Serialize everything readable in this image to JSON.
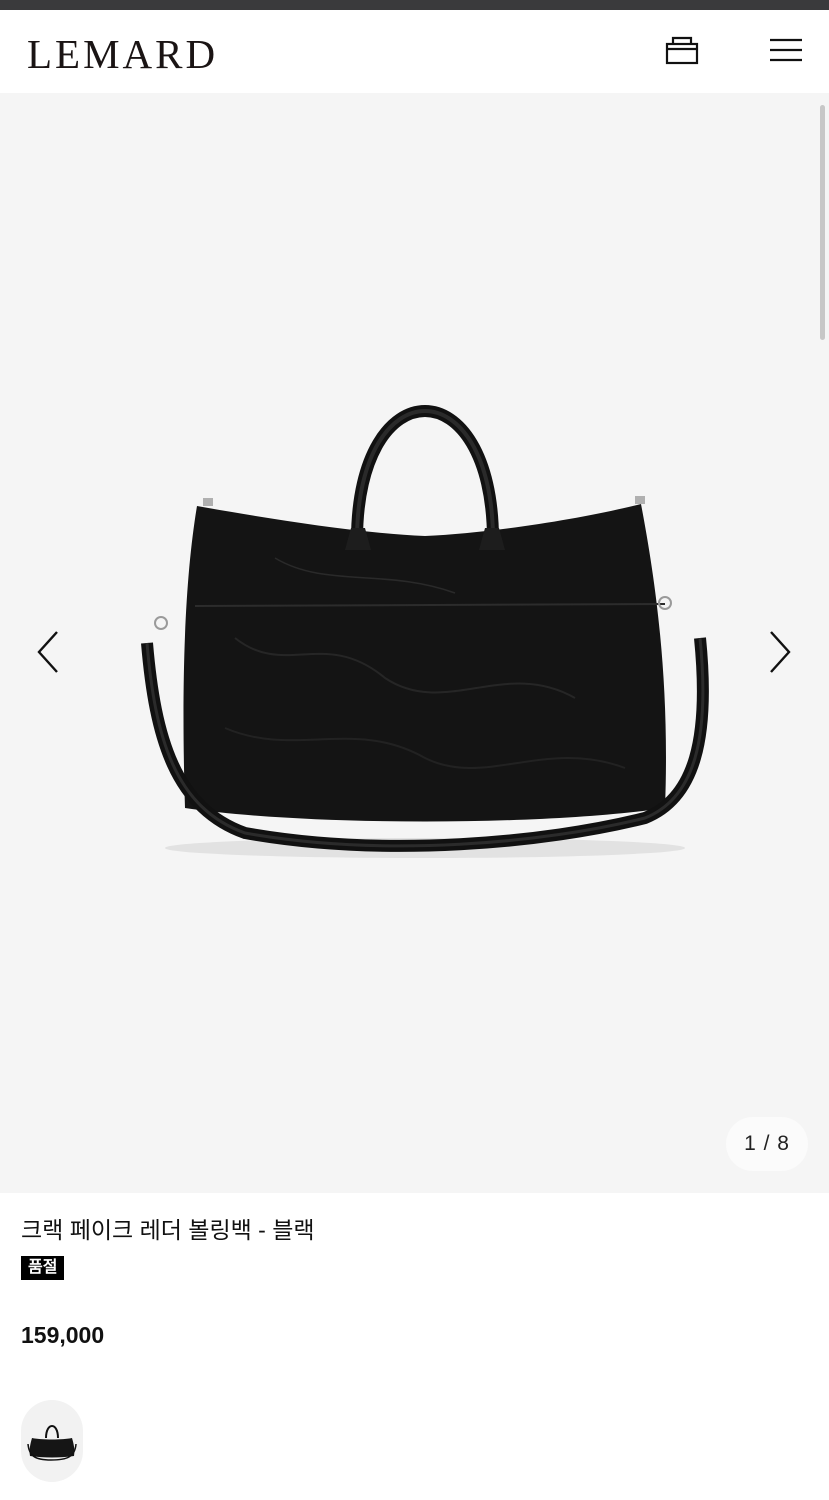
{
  "header": {
    "logo": "LEMARD",
    "cart_icon": "shopping-bag-icon",
    "menu_icon": "hamburger-menu-icon"
  },
  "gallery": {
    "current": 1,
    "total": 8,
    "counter_text": "1 / 8",
    "prev_icon": "chevron-left-icon",
    "next_icon": "chevron-right-icon",
    "background_color": "#f5f5f5"
  },
  "product": {
    "name": "크랙 페이크 레더 볼링백 - 블랙",
    "status_badge": "품절",
    "price": "159,000"
  },
  "colors": {
    "brand": "#1a1414",
    "badge_bg": "#000000"
  }
}
